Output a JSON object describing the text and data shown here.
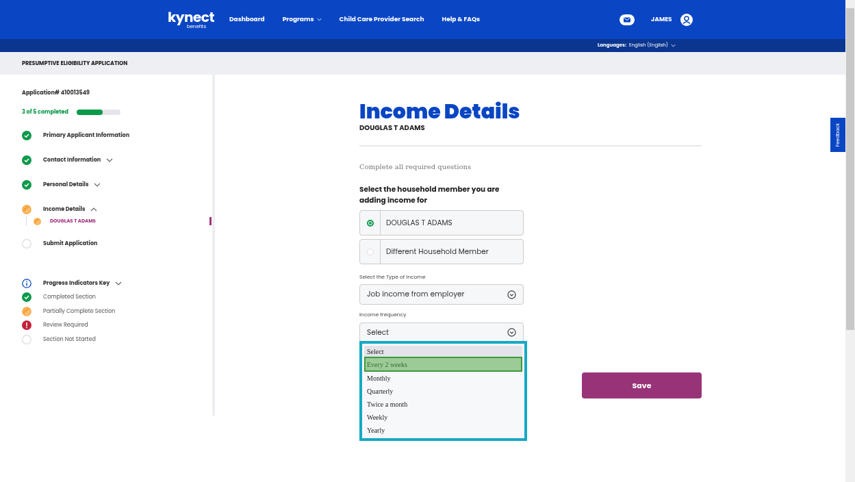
{
  "header": {
    "logo": "kynect",
    "logo_sub": "benefits",
    "nav": [
      {
        "label": "Dashboard",
        "dropdown": false
      },
      {
        "label": "Programs",
        "dropdown": true
      },
      {
        "label": "Child Care Provider Search",
        "dropdown": false
      },
      {
        "label": "Help & FAQs",
        "dropdown": false
      }
    ],
    "user": "JAMES",
    "languages_label": "Languages:",
    "language": "English (English)"
  },
  "page_title": "PRESUMPTIVE ELIGIBILITY APPLICATION",
  "sidebar": {
    "application": "Application#  410013549",
    "progress_text": "3 of 5 completed",
    "progress": {
      "level": 0.6
    },
    "steps": [
      {
        "label": "Primary Applicant Information",
        "kind": "complete"
      },
      {
        "label": "Contact Information",
        "kind": "complete",
        "expanded": false
      },
      {
        "label": "Personal Details",
        "kind": "complete",
        "expanded": false
      },
      {
        "label": "Income Details",
        "kind": "partial",
        "expanded": true,
        "children": [
          {
            "label": "DOUGLAS T ADAMS",
            "kind": "partial",
            "selected": true
          }
        ]
      },
      {
        "label": "Submit Application",
        "kind": "not_started"
      }
    ],
    "key": {
      "title": "Progress Indicators Key",
      "expanded": false,
      "items": [
        {
          "label": "Completed Section",
          "kind": "complete"
        },
        {
          "label": "Partially Complete Section",
          "kind": "partial"
        },
        {
          "label": "Review Required",
          "kind": "review"
        },
        {
          "label": "Section Not Started",
          "kind": "not_started"
        }
      ]
    }
  },
  "main": {
    "title": "Income Details",
    "subtitle": "DOUGLAS T ADAMS",
    "instructions": "Complete all required questions",
    "member_question": "Select the household member you are adding income for",
    "members": [
      {
        "label": "DOUGLAS T ADAMS",
        "selected": true
      },
      {
        "label": "Different Household Member",
        "selected": false
      }
    ],
    "income_type": {
      "label": "Select the Type of Income",
      "value": "Job income from employer"
    },
    "frequency": {
      "label": "Income frequency",
      "value": "Select",
      "options": [
        {
          "label": "Select",
          "selected": true,
          "highlighted": false
        },
        {
          "label": "Every 2 weeks",
          "selected": false,
          "highlighted": true
        },
        {
          "label": "Monthly",
          "selected": false,
          "highlighted": false
        },
        {
          "label": "Quarterly",
          "selected": false,
          "highlighted": false
        },
        {
          "label": "Twice a month",
          "selected": false,
          "highlighted": false
        },
        {
          "label": "Weekly",
          "selected": false,
          "highlighted": false
        },
        {
          "label": "Yearly",
          "selected": false,
          "highlighted": false
        }
      ]
    },
    "save": "Save"
  },
  "feedback": "Feedback"
}
